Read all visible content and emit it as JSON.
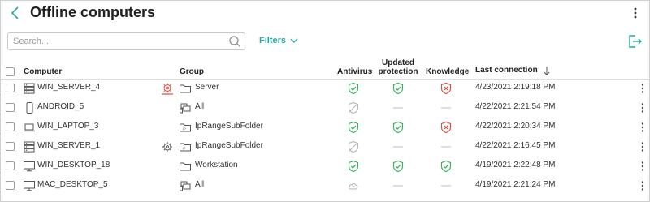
{
  "header": {
    "title": "Offline computers"
  },
  "search": {
    "placeholder": "Search...",
    "value": ""
  },
  "toolbar": {
    "filters_label": "Filters"
  },
  "table": {
    "columns": {
      "computer": "Computer",
      "group": "Group",
      "antivirus": "Antivirus",
      "updated_line1": "Updated",
      "updated_line2": "protection",
      "knowledge": "Knowledge",
      "last_connection": "Last connection"
    },
    "rows": [
      {
        "device_icon": "server-icon",
        "computer": "WIN_SERVER_4",
        "settings_icon": "gear-alert-icon",
        "group_icon": "folder-icon",
        "group": "Server",
        "antivirus": "ok",
        "updated": "ok",
        "knowledge": "error",
        "last_connection": "4/23/2021 2:19:18 PM"
      },
      {
        "device_icon": "mobile-icon",
        "computer": "ANDROID_5",
        "settings_icon": "",
        "group_icon": "all-group-icon",
        "group": "All",
        "antivirus": "disabled",
        "updated": "none",
        "knowledge": "none",
        "last_connection": "4/22/2021 2:21:54 PM"
      },
      {
        "device_icon": "laptop-icon",
        "computer": "WIN_LAPTOP_3",
        "settings_icon": "",
        "group_icon": "ip-folder-icon",
        "group": "IpRangeSubFolder",
        "antivirus": "ok",
        "updated": "ok",
        "knowledge": "error",
        "last_connection": "4/22/2021 2:20:34 PM"
      },
      {
        "device_icon": "server-icon",
        "computer": "WIN_SERVER_1",
        "settings_icon": "gear-icon",
        "group_icon": "ip-folder-icon",
        "group": "IpRangeSubFolder",
        "antivirus": "disabled",
        "updated": "none",
        "knowledge": "none",
        "last_connection": "4/22/2021 2:16:45 PM"
      },
      {
        "device_icon": "desktop-icon",
        "computer": "WIN_DESKTOP_18",
        "settings_icon": "",
        "group_icon": "folder-icon",
        "group": "Workstation",
        "antivirus": "ok",
        "updated": "ok",
        "knowledge": "ok",
        "last_connection": "4/19/2021 2:22:48 PM"
      },
      {
        "device_icon": "desktop-icon",
        "computer": "MAC_DESKTOP_5",
        "settings_icon": "",
        "group_icon": "all-group-icon",
        "group": "All",
        "antivirus": "cloud",
        "updated": "none",
        "knowledge": "none",
        "last_connection": "4/19/2021 2:21:24 PM"
      }
    ]
  },
  "colors": {
    "accent": "#2aa9a0",
    "ok": "#2fae5a",
    "error": "#e0483c",
    "muted": "#b5b5b5",
    "text": "#333333"
  }
}
